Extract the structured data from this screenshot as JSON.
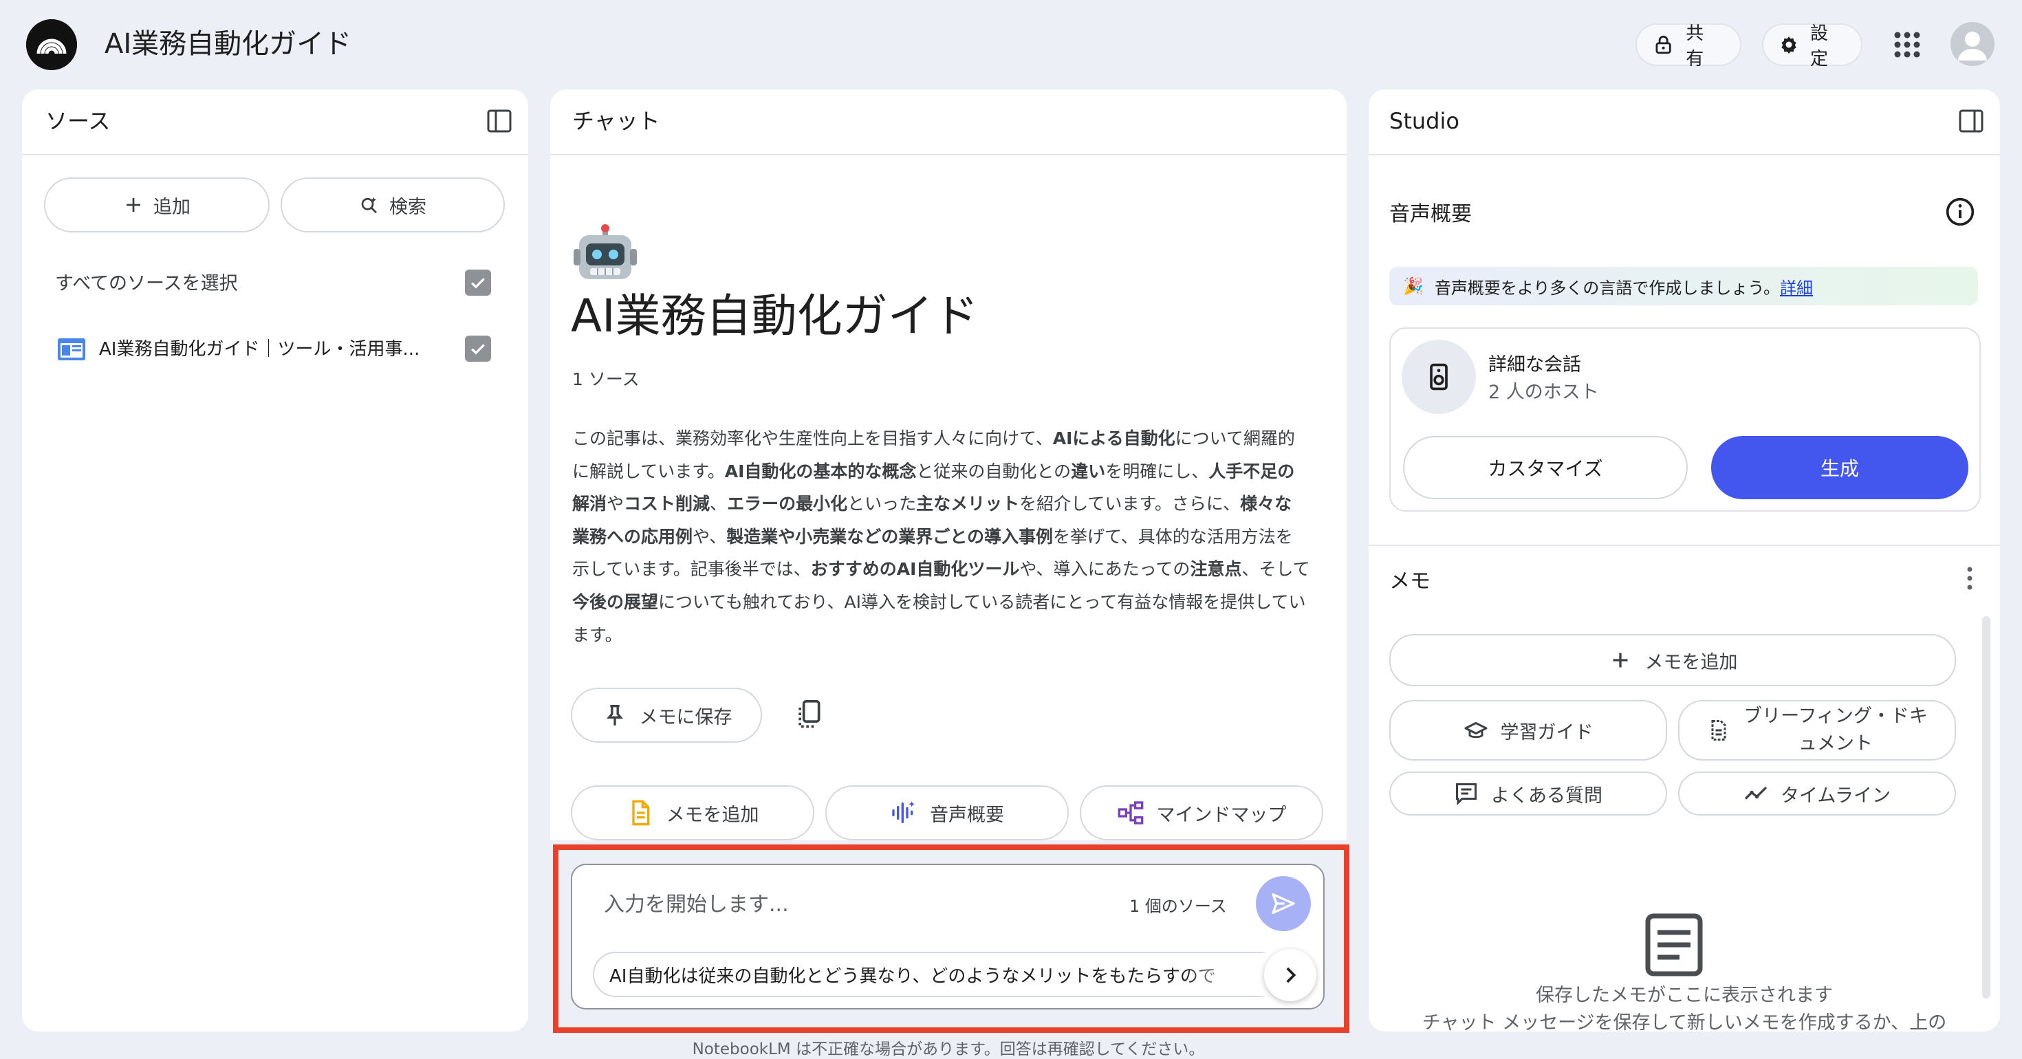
{
  "header": {
    "title": "AI業務自動化ガイド",
    "share_label": "共有",
    "settings_label": "設定"
  },
  "sources": {
    "title": "ソース",
    "add_label": "追加",
    "search_label": "検索",
    "select_all_label": "すべてのソースを選択",
    "select_all_checked": true,
    "items": [
      {
        "label": "AI業務自動化ガイド｜ツール・活用事...",
        "checked": true
      }
    ]
  },
  "chat": {
    "title": "チャット",
    "notebook_emoji": "🤖",
    "notebook_title": "AI業務自動化ガイド",
    "source_count": "1 ソース",
    "summary_lines": [
      [
        [
          "この記事は、業務効率化や生産性向上を目指す人々に向けて、",
          false
        ],
        [
          "AIによる自動化",
          true
        ],
        [
          "について網羅的",
          false
        ]
      ],
      [
        [
          "に解説しています。",
          false
        ],
        [
          "AI自動化の基本的な概念",
          true
        ],
        [
          "と従来の自動化との",
          false
        ],
        [
          "違い",
          true
        ],
        [
          "を明確にし、",
          false
        ],
        [
          "人手不足の",
          true
        ]
      ],
      [
        [
          "解消",
          true
        ],
        [
          "や",
          false
        ],
        [
          "コスト削減",
          true
        ],
        [
          "、",
          false
        ],
        [
          "エラーの最小化",
          true
        ],
        [
          "といった",
          false
        ],
        [
          "主なメリット",
          true
        ],
        [
          "を紹介しています。さらに、",
          false
        ],
        [
          "様々な",
          true
        ]
      ],
      [
        [
          "業務への応用例",
          true
        ],
        [
          "や、",
          false
        ],
        [
          "製造業や小売業などの業界ごとの導入事例",
          true
        ],
        [
          "を挙げて、具体的な活用方法を",
          false
        ]
      ],
      [
        [
          "示しています。記事後半では、",
          false
        ],
        [
          "おすすめのAI自動化ツール",
          true
        ],
        [
          "や、導入にあたっての",
          false
        ],
        [
          "注意点",
          true
        ],
        [
          "、そして",
          false
        ]
      ],
      [
        [
          "今後の展望",
          true
        ],
        [
          "についても触れており、AI導入を検討している読者にとって有益な情報を提供してい",
          false
        ]
      ],
      [
        [
          "ます。",
          false
        ]
      ]
    ],
    "save_to_memo_label": "メモに保存",
    "quick_actions": {
      "add_memo": "メモを追加",
      "audio_overview": "音声概要",
      "mind_map": "マインドマップ"
    },
    "input_placeholder": "入力を開始します...",
    "input_source_count": "1 個のソース",
    "suggestion": "AI自動化は従来の自動化とどう異なり、どのようなメリットをもたらすので",
    "disclaimer": "NotebookLM は不正確な場合があります。回答は再確認してください。"
  },
  "studio": {
    "title": "Studio",
    "audio_section_title": "音声概要",
    "banner_emoji": "🎉",
    "banner_text": "音声概要をより多くの言語で作成しましょう。",
    "banner_link": "詳細",
    "audio_card_title": "詳細な会話",
    "audio_card_subtitle": "2 人のホスト",
    "customize_label": "カスタマイズ",
    "generate_label": "生成",
    "memo_title": "メモ",
    "add_memo_label": "メモを追加",
    "study_guide_label": "学習ガイド",
    "briefing_line1": "ブリーフィング・ドキ",
    "briefing_line2": "ュメント",
    "faq_label": "よくある質問",
    "timeline_label": "タイムライン",
    "empty_title": "保存したメモがここに表示されます",
    "empty_desc": "チャット メッセージを保存して新しいメモを作成するか、上の"
  },
  "colors": {
    "accent": "#4356ee",
    "send_button": "#a7b1f5",
    "highlight_border": "#e8402a",
    "background": "#eceff6"
  }
}
